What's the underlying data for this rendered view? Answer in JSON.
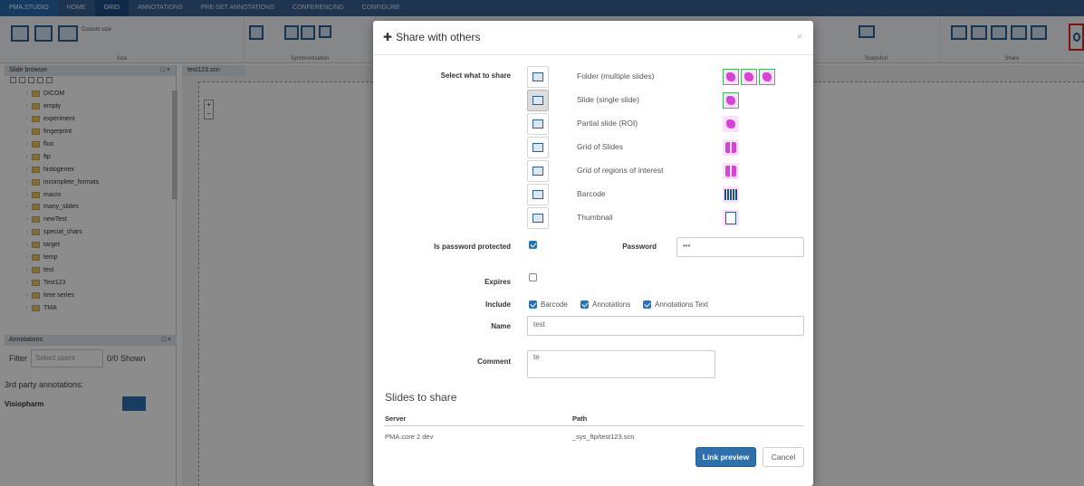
{
  "app": {
    "tabs": [
      "PMA.STUDIO",
      "HOME",
      "GRID",
      "ANNOTATIONS",
      "PRE-SET ANNOTATIONS",
      "CONFERENCING",
      "CONFIGURE"
    ],
    "ribbon": {
      "custom_size": "Custom size",
      "groups": [
        "Size",
        "Synchronization",
        "Snapshot",
        "Share"
      ]
    },
    "slide_browser": {
      "title": "Slide browser",
      "folders": [
        "DICOM",
        "empty",
        "experiment",
        "fingerprint",
        "fluo",
        "ftp",
        "histogenex",
        "incomplete_formats",
        "macro",
        "many_slides",
        "newTest",
        "special_chars",
        "target",
        "temp",
        "test",
        "Test123",
        "time series",
        "TMA"
      ]
    },
    "annotations_panel": {
      "title": "Annotations",
      "filter_label": "Filter",
      "select_users_placeholder": "Select users",
      "shown_count": "0/0 Shown",
      "third_party_label": "3rd party annotations:",
      "visiopharm": "Visiopharm"
    },
    "viewer_tab": "test123.scn",
    "zoom_in": "+",
    "zoom_out": "−"
  },
  "modal": {
    "title": "Share with others",
    "close": "×",
    "select_label": "Select what to share",
    "options": [
      {
        "label": "Folder (multiple slides)",
        "icon": "folder-icon",
        "selected": false
      },
      {
        "label": "Slide (single slide)",
        "icon": "slide-icon",
        "selected": true
      },
      {
        "label": "Partial slide (ROI)",
        "icon": "roi-icon",
        "selected": false
      },
      {
        "label": "Grid of Slides",
        "icon": "grid-slides-icon",
        "selected": false
      },
      {
        "label": "Grid of regions of interest",
        "icon": "grid-roi-icon",
        "selected": false
      },
      {
        "label": "Barcode",
        "icon": "barcode-icon",
        "selected": false
      },
      {
        "label": "Thumbnail",
        "icon": "thumbnail-icon",
        "selected": false
      }
    ],
    "password_protected_label": "Is password protected",
    "password_protected": true,
    "password_label": "Password",
    "password_value": "•••",
    "expires_label": "Expires",
    "expires": false,
    "include_label": "Include",
    "include_options": [
      {
        "label": "Barcode",
        "checked": true
      },
      {
        "label": "Annotations",
        "checked": true
      },
      {
        "label": "Annotations Text",
        "checked": true
      }
    ],
    "name_label": "Name",
    "name_value": "test",
    "comment_label": "Comment",
    "comment_value": "te",
    "slides_section_title": "Slides to share",
    "table_headers": {
      "server": "Server",
      "path": "Path"
    },
    "table_rows": [
      {
        "server": "PMA.core 2 dev",
        "path": "_sys_ftp/test123.scn"
      }
    ],
    "link_preview_button": "Link preview",
    "cancel_button": "Cancel"
  },
  "colors": {
    "primary": "#2f6fab",
    "checkbox": "#2a73b8",
    "preview_border": "#3ebd5b",
    "preview_fill": "#d445d4",
    "highlight": "#e02020"
  }
}
